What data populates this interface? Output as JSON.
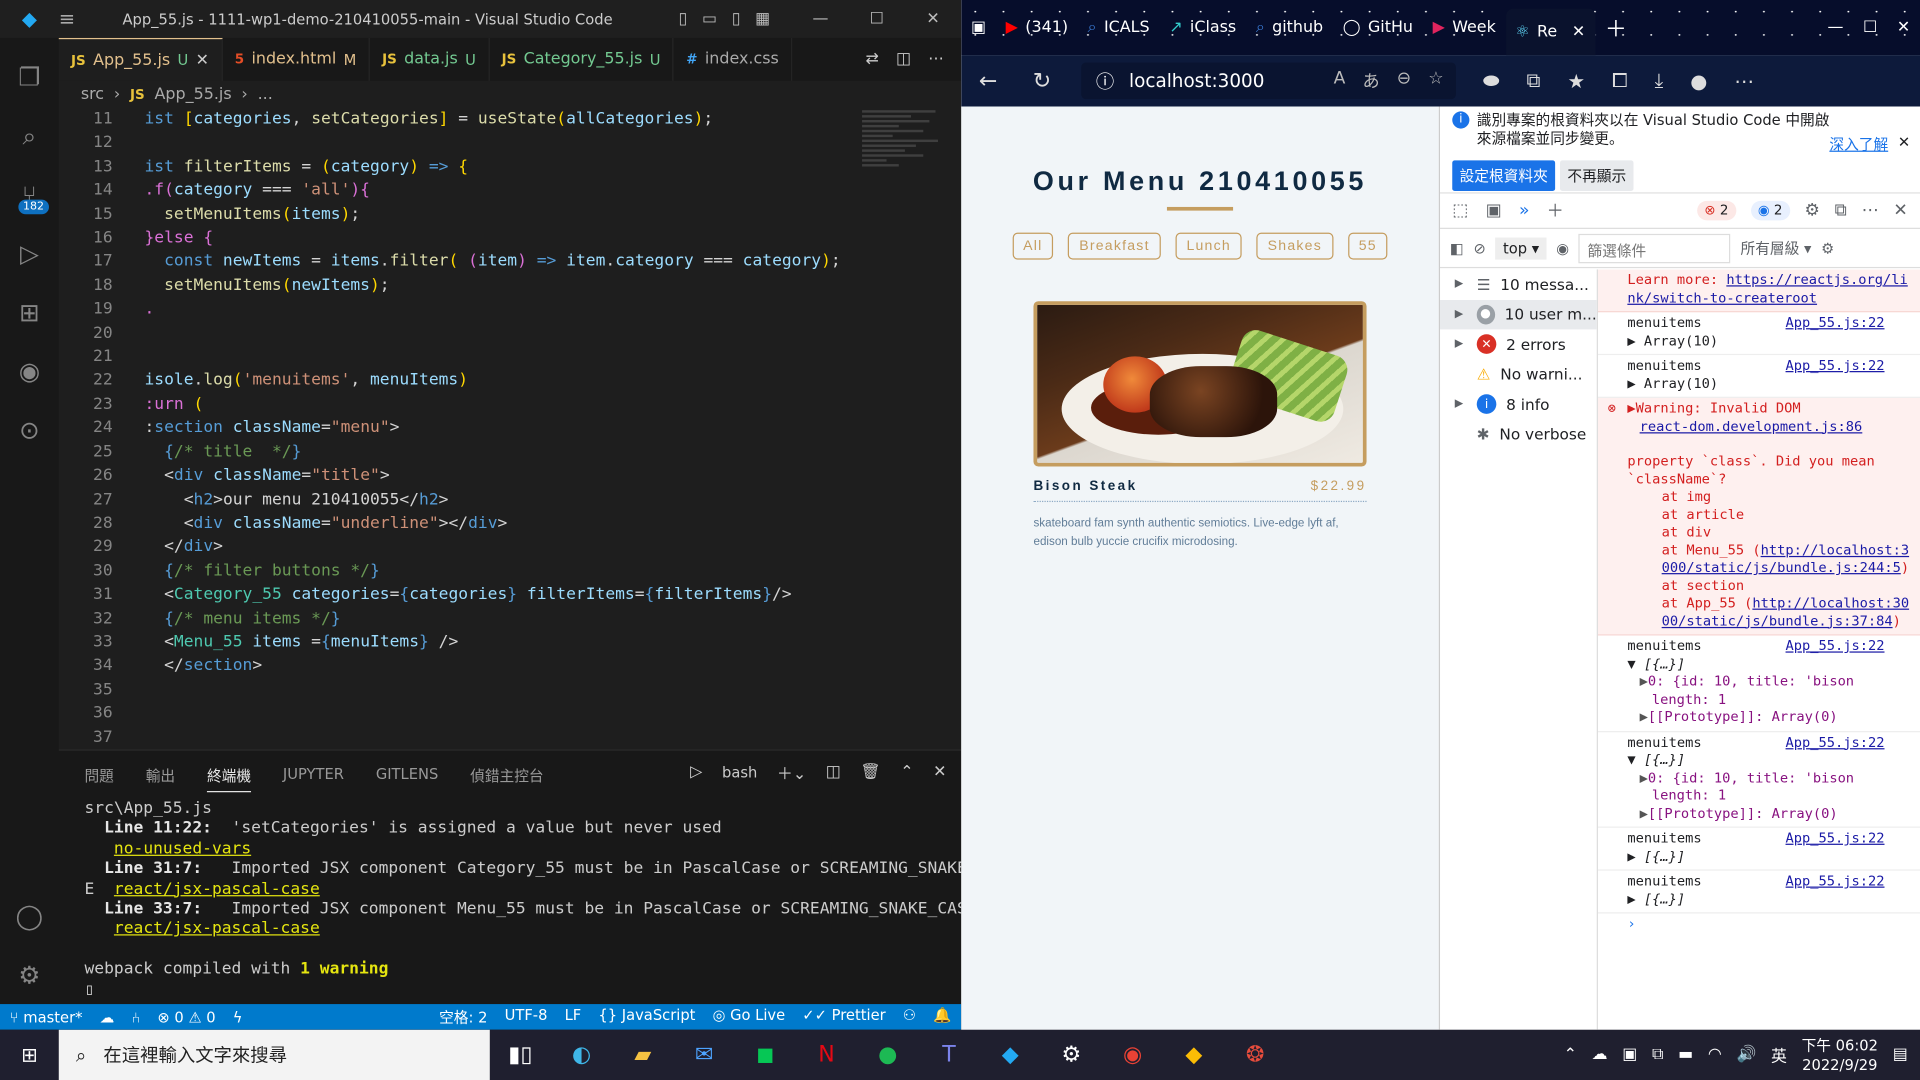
{
  "vscode": {
    "window_title": "App_55.js - 1111-wp1-demo-210410055-main - Visual Studio Code",
    "tabs": [
      {
        "label": "App_55.js",
        "status": "U",
        "icon": "JS"
      },
      {
        "label": "index.html",
        "status": "M",
        "icon": "5"
      },
      {
        "label": "data.js",
        "status": "U",
        "icon": "JS"
      },
      {
        "label": "Category_55.js",
        "status": "U",
        "icon": "JS"
      },
      {
        "label": "index.css",
        "status": "",
        "icon": "#"
      }
    ],
    "breadcrumb": [
      "src",
      "App_55.js",
      "..."
    ],
    "scm_badge": "182",
    "code_lines": [
      "11",
      "12",
      "13",
      "14",
      "15",
      "16",
      "17",
      "18",
      "19",
      "20",
      "21",
      "22",
      "23",
      "24",
      "25",
      "26",
      "27",
      "28",
      "29",
      "30",
      "31",
      "32",
      "33",
      "34",
      "35",
      "36",
      "37"
    ],
    "panel_tabs": [
      "問題",
      "輸出",
      "終端機",
      "JUPYTER",
      "GITLENS",
      "偵錯主控台"
    ],
    "terminal_shell": "bash",
    "terminal": {
      "file": "src\\App_55.js",
      "w1_loc": "Line 11:22:",
      "w1_msg": "  'setCategories' is assigned a value but never used",
      "w1_rule": "no-unused-vars",
      "w2_loc": "Line 31:7:",
      "w2_msg": "   Imported JSX component Category_55 must be in PascalCase or SCREAMING_SNAKE_CAS",
      "w2_wrap": "E",
      "w2_rule": "react/jsx-pascal-case",
      "w3_loc": "Line 33:7:",
      "w3_msg": "   Imported JSX component Menu_55 must be in PascalCase or SCREAMING_SNAKE_CASE",
      "w3_rule": "react/jsx-pascal-case",
      "compiled": "webpack compiled with ",
      "warn_count": "1 warning"
    },
    "status": {
      "branch": "master*",
      "errors": "0",
      "warnings": "0",
      "spaces": "空格: 2",
      "encoding": "UTF-8",
      "eol": "LF",
      "language": "JavaScript",
      "golive": "Go Live",
      "prettier": "Prettier"
    }
  },
  "edge": {
    "tabs": [
      "(341)",
      "ICALS",
      "iClass",
      "github",
      "GitHu",
      "Week",
      "Re"
    ],
    "url": "localhost:3000",
    "page": {
      "title": "Our Menu 210410055",
      "filters": [
        "All",
        "Breakfast",
        "Lunch",
        "Shakes",
        "55"
      ],
      "item_name": "Bison Steak",
      "item_price": "$22.99",
      "item_desc": "skateboard fam synth authentic semiotics. Live-edge lyft af, edison bulb yuccie crucifix microdosing."
    }
  },
  "devtools": {
    "notice_text": "識別專案的根資料夾以在 Visual Studio Code 中開啟來源檔案並同步變更。",
    "notice_more": "深入了解",
    "btn_primary": "設定根資料夾",
    "btn_dismiss": "不再顯示",
    "error_count": "2",
    "msg_count": "2",
    "context": "top",
    "filter_placeholder": "篩選條件",
    "levels": "所有層級",
    "side": [
      "10 messa...",
      "10 user m...",
      "2 errors",
      "No warni...",
      "8 info",
      "No verbose"
    ],
    "console": {
      "learn_more": "Learn more: ",
      "learn_link": "https://reactjs.org/link/switch-to-createroot",
      "label": "menuitems",
      "src": "App_55.js:22",
      "arr": "Array(10)",
      "warn_head": "Warning: Invalid DOM",
      "warn_src": "react-dom.development.js:86",
      "warn_body": "property `class`. Did you mean `className`?",
      "at_img": "at img",
      "at_article": "at article",
      "at_div": "at div",
      "at_menu": "at Menu_55 (",
      "menu_link": "http://localhost:3000/static/js/bundle.js:244:5",
      "at_section": "at section",
      "at_app": "at App_55 (",
      "app_link": "http://localhost:3000/static/js/bundle.js:37:84",
      "obj": "[{…}]",
      "item0": "0: {id: 10, title: 'bison",
      "length": "length: 1",
      "proto": "[[Prototype]]: Array(0)",
      "collapsed": "[{…}]"
    }
  },
  "taskbar": {
    "search_placeholder": "在這裡輸入文字來搜尋",
    "ime": "英",
    "time": "下午 06:02",
    "date": "2022/9/29"
  }
}
